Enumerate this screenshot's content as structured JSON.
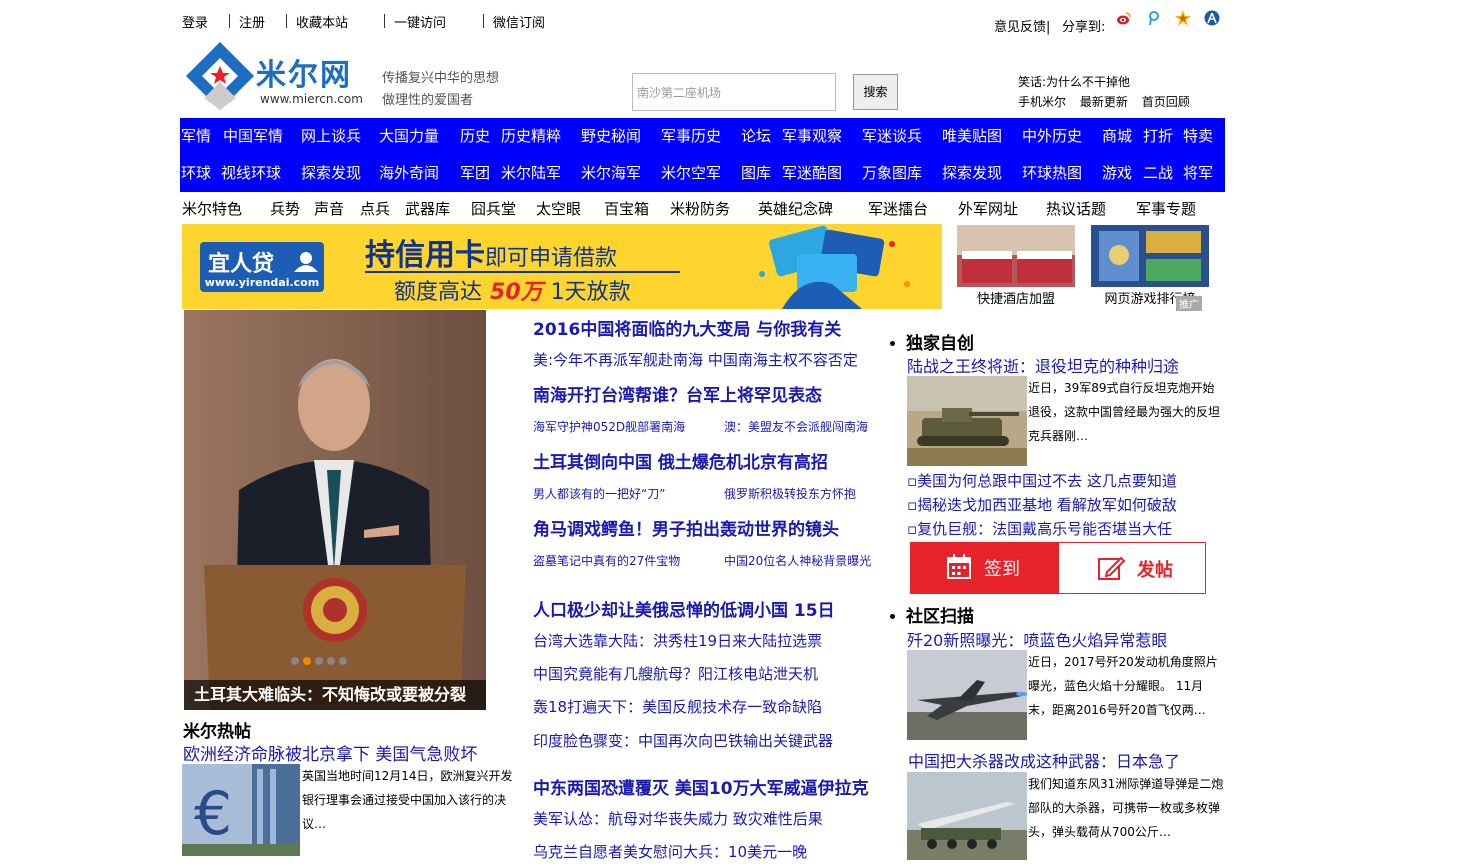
{
  "top": {
    "links": [
      "登录",
      "注册",
      "收藏本站",
      "一键访问",
      "微信订阅"
    ],
    "feedback": "意见反馈",
    "share_label": "分享到:"
  },
  "logo": {
    "name": "米尔网",
    "url_text": "www.miercn.com"
  },
  "slogan": {
    "line1": "传播复兴中华的思想",
    "line2": "做理性的爱国者"
  },
  "search": {
    "placeholder": "南沙第二座机场",
    "button": "搜索"
  },
  "right_links": {
    "joke": "笑话:为什么不干掉他",
    "items": [
      "手机米尔",
      "最新更新",
      "首页回顾"
    ]
  },
  "nav": {
    "row1": [
      "军情",
      "中国军情",
      "网上谈兵",
      "大国力量",
      "历史",
      "历史精粹",
      "野史秘闻",
      "军事历史",
      "论坛",
      "军事观察",
      "军迷谈兵",
      "唯美贴图",
      "中外历史",
      "商城",
      "打折",
      "特卖"
    ],
    "row2": [
      "环球",
      "视线环球",
      "探索发现",
      "海外奇闻",
      "军团",
      "米尔陆军",
      "米尔海军",
      "米尔空军",
      "图库",
      "军迷酷图",
      "万象图库",
      "探索发现",
      "环球热图",
      "游戏",
      "二战",
      "将军"
    ],
    "row3": [
      "米尔特色",
      "兵势",
      "声音",
      "点兵",
      "武器库",
      "囧兵堂",
      "太空眼",
      "百宝箱",
      "米粉防务",
      "英雄纪念碑",
      "军迷擂台",
      "外军网址",
      "热议话题",
      "军事专题"
    ]
  },
  "banner": {
    "brand": "宜人贷",
    "brand_url": "www.yirendai.com",
    "title_bold": "持信用卡",
    "title_rest": "即可申请借款",
    "line2_pre": "额度高达",
    "amount": "50万",
    "days": "1天放款"
  },
  "thumbs": [
    {
      "caption": "快捷酒店加盟"
    },
    {
      "caption": "网页游戏排行榜"
    }
  ],
  "ad_tag": "推广",
  "slideshow": {
    "caption": "土耳其大难临头：不知悔改或要被分裂"
  },
  "hot_posts": {
    "title": "米尔热帖",
    "headline": "欧洲经济命脉被北京拿下  美国气急败坏",
    "excerpt": "英国当地时间12月14日，欧洲复兴开发银行理事会通过接受中国加入该行的决议…"
  },
  "center": {
    "h1": "2016中国将面临的九大变局  与你我有关",
    "m1": "美:今年不再派军舰赴南海  中国南海主权不容否定",
    "h2": "南海开打台湾帮谁？台军上将罕见表态",
    "s2a": "海军守护神052D舰部署南海",
    "s2b": "澳：美盟友不会派舰闯南海",
    "h3": "土耳其倒向中国  俄土爆危机北京有高招",
    "s3a": "男人都该有的一把好“刀”",
    "s3b": "俄罗斯积极转投东方怀抱",
    "h4": "角马调戏鳄鱼！男子拍出轰动世界的镜头",
    "s4a": "盗墓笔记中真有的27件宝物",
    "s4b": "中国20位名人神秘背景曝光",
    "h5": "人口极少却让美俄忌惮的低调小国  15日",
    "list5": [
      "台湾大选靠大陆：洪秀柱19日来大陆拉选票",
      "中国究竟能有几艘航母？阳江核电站泄天机",
      "轰18打遍天下：美国反舰技术存一致命缺陷",
      "印度脸色骤变：中国再次向巴铁输出关键武器"
    ],
    "h6": "中东两国恐遭覆灭  美国10万大军威逼伊拉克",
    "list6": [
      "美军认怂：航母对华丧失威力  致灾难性后果",
      "乌克兰自愿者美女慰问大兵：10美元一晚"
    ]
  },
  "right": {
    "sec1_title": "独家自创",
    "sec1_headline": "陆战之王终将逝：退役坦克的种种归途",
    "sec1_excerpt": "近日，39军89式自行反坦克炮开始退役，这款中国曾经最为强大的反坦克兵器刚…",
    "sec1_list": [
      "▫美国为何总跟中国过不去  这几点要知道",
      "▫揭秘迭戈加西亚基地  看解放军如何破敌",
      "▫复仇巨舰：法国戴高乐号能否堪当大任"
    ],
    "checkin": "签到",
    "post": "发帖",
    "sec2_title": "社区扫描",
    "sec2_headline": "歼20新照曝光：喷蓝色火焰异常惹眼",
    "sec2_excerpt": "近日，2017号歼20发动机角度照片曝光，蓝色火焰十分耀眼。 11月末，距离2016号歼20首飞仅两…",
    "sec3_headline": "中国把大杀器改成这种武器：日本急了",
    "sec3_excerpt": "我们知道东风31洲际弹道导弹是二炮部队的大杀器，可携带一枚或多枚弹头，弹头载荷从700公斤…"
  },
  "colors": {
    "nav_blue": "#0000ff",
    "link_blue": "#1a1ab3",
    "checkin_red": "#e8222a",
    "banner_yellow": "#fdd52e"
  }
}
